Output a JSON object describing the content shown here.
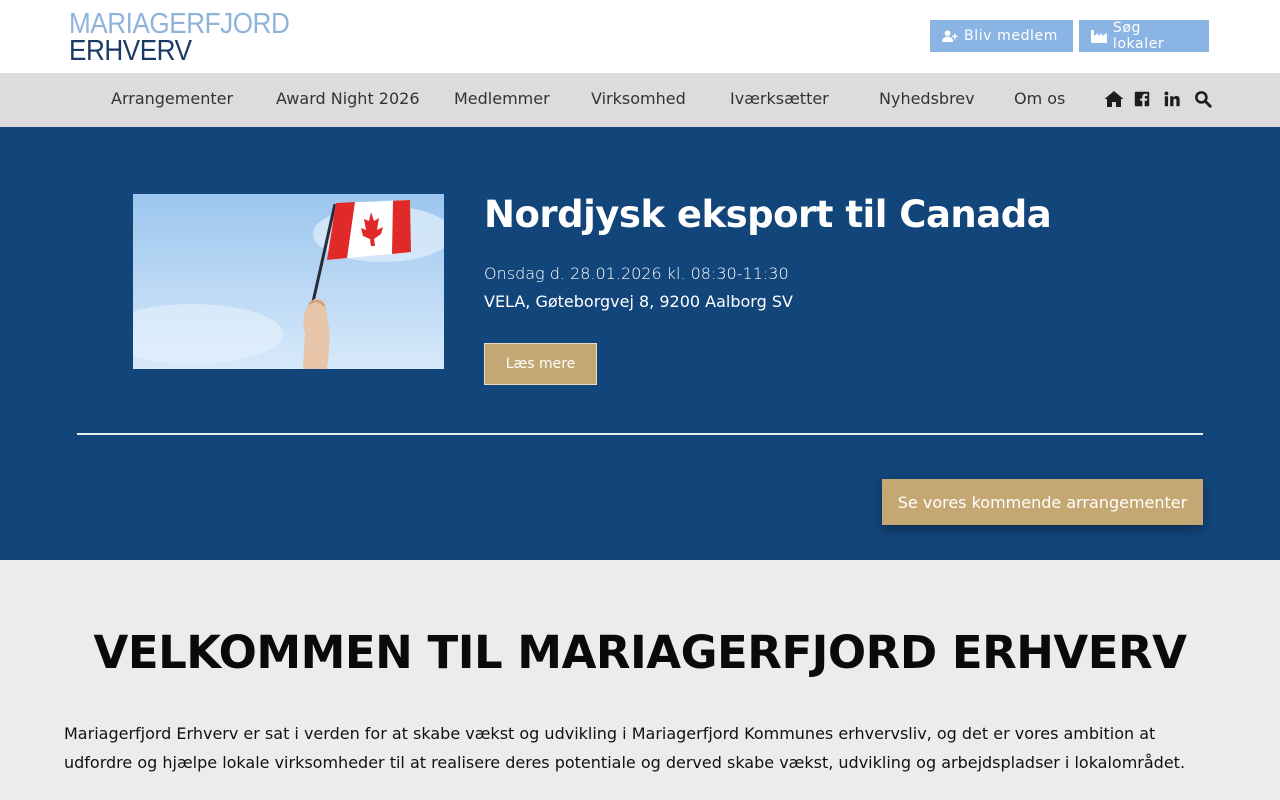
{
  "header": {
    "logo_line1": "MARIAGERFJORD",
    "logo_line2": "ERHVERV",
    "member_button": "Bliv medlem",
    "premises_button": "Søg lokaler"
  },
  "nav": {
    "items": [
      "Arrangementer",
      "Award Night 2026",
      "Medlemmer",
      "Virksomhed",
      "Iværksætter",
      "Nyhedsbrev",
      "Om os"
    ],
    "icons": [
      "home-icon",
      "facebook-icon",
      "linkedin-icon",
      "search-icon"
    ]
  },
  "hero": {
    "event_title": "Nordjysk eksport til Canada",
    "event_date": "Onsdag d. 28.01.2026 kl. 08:30-11:30",
    "event_place": "VELA, Gøteborgvej 8, 9200 Aalborg SV",
    "read_more": "Læs mere",
    "upcoming_button": "Se vores kommende arrangementer"
  },
  "welcome": {
    "title": "VELKOMMEN TIL MARIAGERFJORD ERHVERV",
    "text": "Mariagerfjord Erhverv er sat i verden for at skabe vækst og udvikling i Mariagerfjord Kommunes erhvervsliv, og det er vores ambition at udfordre og hjælpe lokale virksomheder til at realisere deres potentiale og derved skabe vækst, udvikling og  arbejdspladser i lokalområdet."
  },
  "colors": {
    "header_bg": "#ffffff",
    "nav_bg": "#dcdcdc",
    "hero_bg": "#12457a",
    "gold_button": "#c4a772",
    "light_blue_button": "#8ab4e3",
    "page_bg": "#ececec"
  }
}
